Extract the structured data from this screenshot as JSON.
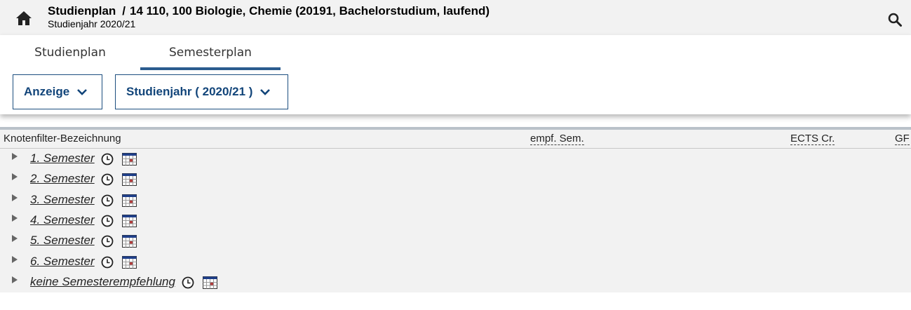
{
  "header": {
    "title_main": "Studienplan",
    "title_sep": "/",
    "title_detail": "14 110, 100 Biologie, Chemie (20191, Bachelorstudium, laufend)",
    "subtitle": "Studienjahr 2020/21",
    "home_icon": "home-icon",
    "search_icon": "search-icon"
  },
  "tabs": [
    {
      "label": "Studienplan",
      "active": false
    },
    {
      "label": "Semesterplan",
      "active": true
    }
  ],
  "dropdowns": {
    "anzeige": "Anzeige",
    "studienjahr": "Studienjahr ( 2020/21 )"
  },
  "table": {
    "columns": [
      "Knotenfilter-Bezeichnung",
      "empf. Sem.",
      "ECTS Cr.",
      "GF"
    ],
    "rows": [
      {
        "label": "1. Semester"
      },
      {
        "label": "2. Semester"
      },
      {
        "label": "3. Semester"
      },
      {
        "label": "4. Semester"
      },
      {
        "label": "5. Semester"
      },
      {
        "label": "6. Semester"
      },
      {
        "label": "keine Semesterempfehlung"
      }
    ]
  },
  "colors": {
    "accent": "#12457a",
    "tab_underline": "#2b5c8f",
    "header_bg": "#f2f2f2"
  }
}
